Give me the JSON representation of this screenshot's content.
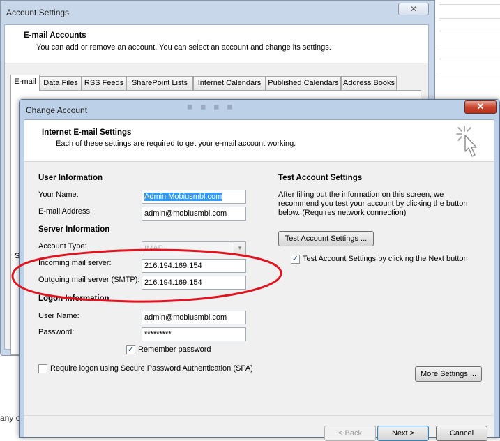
{
  "back_window": {
    "title": "Account Settings",
    "close_glyph": "✕",
    "header_title": "E-mail Accounts",
    "header_subtitle": "You can add or remove an account. You can select an account and change its settings.",
    "tabs": [
      "E-mail",
      "Data Files",
      "RSS Feeds",
      "SharePoint Lists",
      "Internet Calendars",
      "Published Calendars",
      "Address Books"
    ],
    "truncated_label": "S"
  },
  "background_fragment": "any c",
  "dialog": {
    "title": "Change Account",
    "close_glyph": "✕",
    "header_title": "Internet E-mail Settings",
    "header_subtitle": "Each of these settings are required to get your e-mail account working.",
    "user_info": {
      "heading": "User Information",
      "name_label": "Your Name:",
      "name_value": "Admin Mobiusmbl.com",
      "email_label": "E-mail Address:",
      "email_value": "admin@mobiusmbl.com"
    },
    "server_info": {
      "heading": "Server Information",
      "account_type_label": "Account Type:",
      "account_type_value": "IMAP",
      "incoming_label": "Incoming mail server:",
      "incoming_value": "216.194.169.154",
      "outgoing_label": "Outgoing mail server (SMTP):",
      "outgoing_value": "216.194.169.154"
    },
    "logon_info": {
      "heading": "Logon Information",
      "username_label": "User Name:",
      "username_value": "admin@mobiusmbl.com",
      "password_label": "Password:",
      "password_value": "*********",
      "remember_label": "Remember password",
      "remember_checked": true,
      "spa_label": "Require logon using Secure Password Authentication (SPA)",
      "spa_checked": false
    },
    "test": {
      "heading": "Test Account Settings",
      "description": "After filling out the information on this screen, we recommend you test your account by clicking the button below. (Requires network connection)",
      "button": "Test Account Settings ...",
      "next_check_label": "Test Account Settings by clicking the Next button",
      "next_checked": true
    },
    "buttons": {
      "more_settings": "More Settings ...",
      "back": "< Back",
      "next": "Next >",
      "cancel": "Cancel"
    },
    "check_glyph": "✓",
    "dropdown_glyph": "▼"
  },
  "colors": {
    "highlight_ellipse": "#e0141e",
    "selection": "#3399ff",
    "title_close": "#c8452e"
  }
}
